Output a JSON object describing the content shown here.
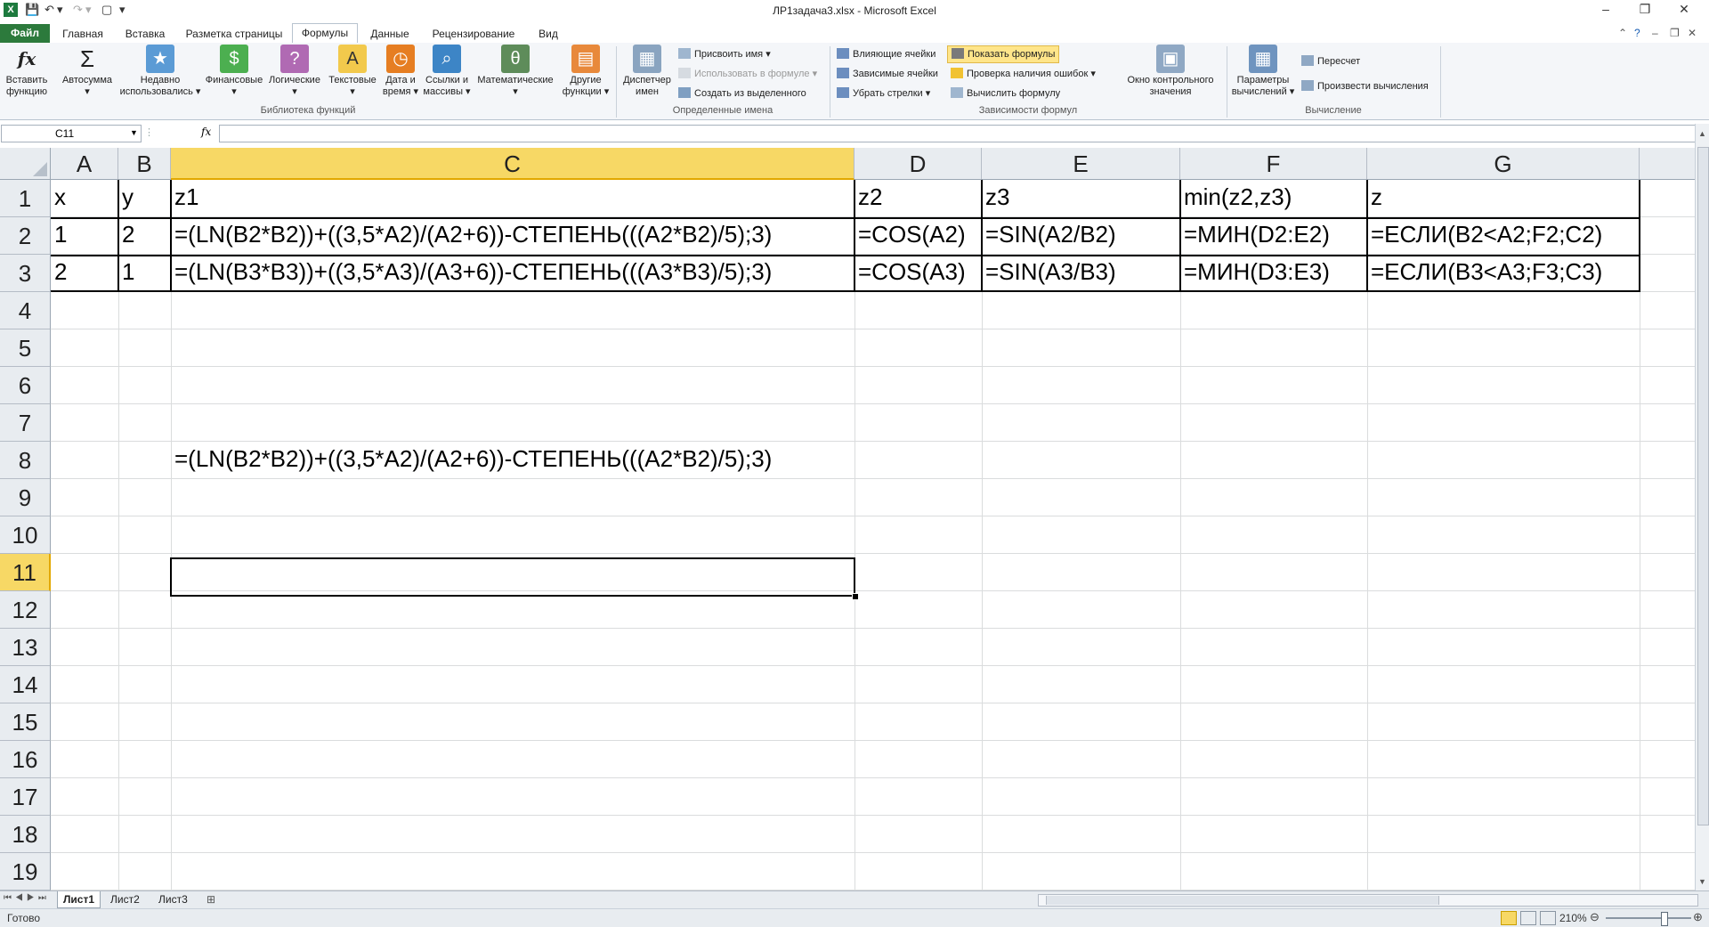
{
  "window": {
    "title": "ЛР1задача3.xlsx  -  Microsoft Excel",
    "minimize": "–",
    "restore": "❐",
    "close": "✕"
  },
  "tabs": [
    "Файл",
    "Главная",
    "Вставка",
    "Разметка страницы",
    "Формулы",
    "Данные",
    "Рецензирование",
    "Вид"
  ],
  "active_tab": "Формулы",
  "ribbon": {
    "function_library": {
      "buttons": [
        {
          "line1": "Вставить",
          "line2": "функцию",
          "icon": "fx-icon"
        },
        {
          "line1": "Автосумма",
          "line2": "▾",
          "icon": "sigma-icon"
        },
        {
          "line1": "Недавно",
          "line2": "использовались ▾",
          "icon": "book-star-icon"
        },
        {
          "line1": "Финансовые",
          "line2": "▾",
          "icon": "book-money-icon"
        },
        {
          "line1": "Логические",
          "line2": "▾",
          "icon": "book-question-icon"
        },
        {
          "line1": "Текстовые",
          "line2": "▾",
          "icon": "book-text-icon"
        },
        {
          "line1": "Дата и",
          "line2": "время ▾",
          "icon": "book-clock-icon"
        },
        {
          "line1": "Ссылки и",
          "line2": "массивы ▾",
          "icon": "book-search-icon"
        },
        {
          "line1": "Математические",
          "line2": "▾",
          "icon": "book-theta-icon"
        },
        {
          "line1": "Другие",
          "line2": "функции ▾",
          "icon": "books-icon"
        }
      ],
      "label": "Библиотека функций"
    },
    "defined_names": {
      "manager_line1": "Диспетчер",
      "manager_line2": "имен",
      "assign": "Присвоить имя ▾",
      "use_in_formula": "Использовать в формуле ▾",
      "create_from_selection": "Создать из выделенного",
      "label": "Определенные имена"
    },
    "formula_auditing": {
      "trace_precedents": "Влияющие ячейки",
      "trace_dependents": "Зависимые ячейки",
      "remove_arrows": "Убрать стрелки ▾",
      "show_formulas": "Показать формулы",
      "error_checking": "Проверка наличия ошибок ▾",
      "evaluate": "Вычислить формулу",
      "watch_line1": "Окно контрольного",
      "watch_line2": "значения",
      "label": "Зависимости формул"
    },
    "calculation": {
      "options_line1": "Параметры",
      "options_line2": "вычислений ▾",
      "calc_now": "Пересчет",
      "calc_sheet": "Произвести вычисления",
      "label": "Вычисление"
    }
  },
  "formula_bar": {
    "name_box": "C11",
    "fx": "fx",
    "value": ""
  },
  "grid": {
    "columns": [
      "A",
      "B",
      "C",
      "D",
      "E",
      "F",
      "G"
    ],
    "selected_column": "C",
    "rows": [
      "1",
      "2",
      "3",
      "4",
      "5",
      "6",
      "7",
      "8",
      "9",
      "10",
      "11",
      "12",
      "13",
      "14",
      "15",
      "16",
      "17",
      "18",
      "19"
    ],
    "selected_row": "11",
    "cells": {
      "A1": "x",
      "B1": "y",
      "C1": "z1",
      "D1": "z2",
      "E1": "z3",
      "F1": "min(z2,z3)",
      "G1": "z",
      "A2": "1",
      "B2": "2",
      "C2": "=(LN(B2*B2))+((3,5*A2)/(A2+6))-СТЕПЕНЬ(((A2*B2)/5);3)",
      "D2": "=COS(A2)",
      "E2": "=SIN(A2/B2)",
      "F2": "=МИН(D2:E2)",
      "G2": "=ЕСЛИ(B2<A2;F2;C2)",
      "A3": "2",
      "B3": "1",
      "C3": "=(LN(B3*B3))+((3,5*A3)/(A3+6))-СТЕПЕНЬ(((A3*B3)/5);3)",
      "D3": "=COS(A3)",
      "E3": "=SIN(A3/B3)",
      "F3": "=МИН(D3:E3)",
      "G3": "=ЕСЛИ(B3<A3;F3;C3)",
      "C8": "=(LN(B2*B2))+((3,5*A2)/(A2+6))-СТЕПЕНЬ(((A2*B2)/5);3)"
    }
  },
  "sheets": [
    "Лист1",
    "Лист2",
    "Лист3"
  ],
  "active_sheet": "Лист1",
  "status": {
    "ready": "Готово",
    "zoom": "210%"
  }
}
